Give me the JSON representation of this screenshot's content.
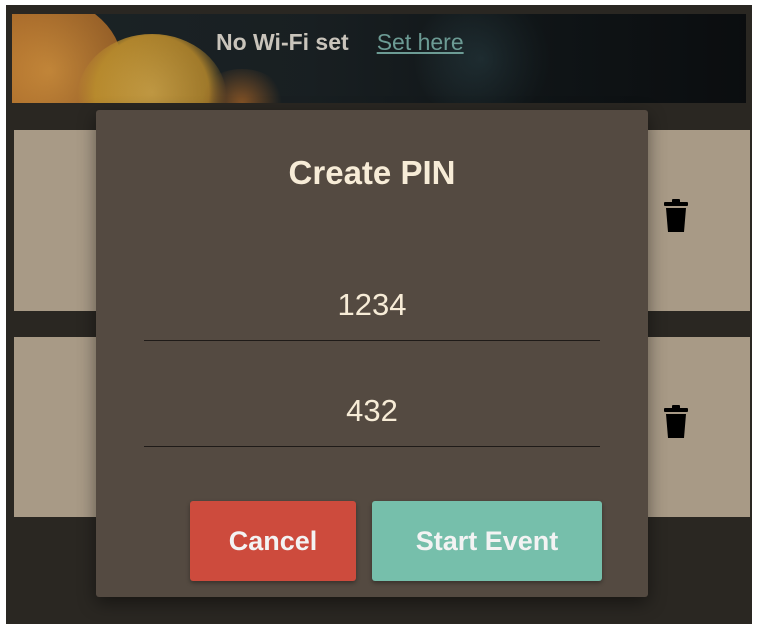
{
  "banner": {
    "wifi_status": "No Wi-Fi set",
    "wifi_link": "Set here"
  },
  "list": {
    "items": [
      {
        "delete_icon": "trash-icon"
      },
      {
        "delete_icon": "trash-icon"
      }
    ]
  },
  "dialog": {
    "title": "Create PIN",
    "pin_value": "1234",
    "pin_confirm_value": "432",
    "cancel_label": "Cancel",
    "start_label": "Start Event"
  },
  "colors": {
    "dialog_bg": "#544a41",
    "cancel": "#cd4b3d",
    "start": "#76bfab",
    "card": "#a89a86",
    "text_light": "#f7ecd7"
  }
}
